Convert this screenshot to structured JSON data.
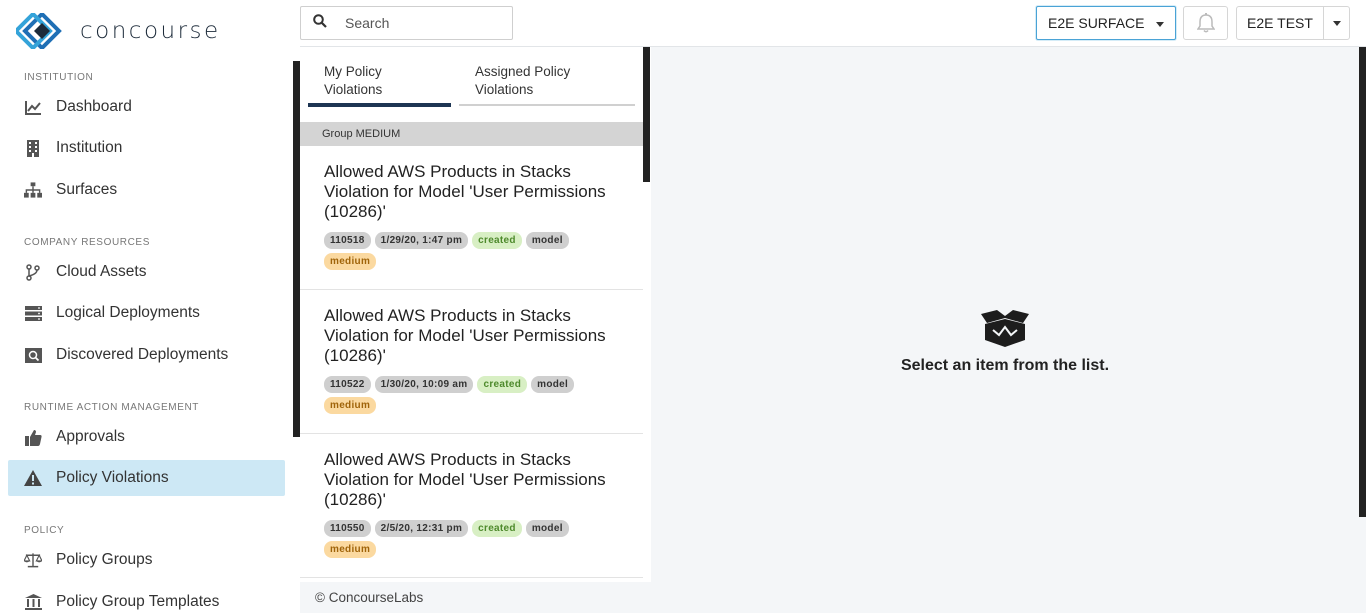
{
  "app": {
    "logo_text": "concourse",
    "brand_color": "#1f6fb5"
  },
  "sidebar": {
    "sections": [
      {
        "title": "INSTITUTION"
      },
      {
        "title": "COMPANY RESOURCES"
      },
      {
        "title": "RUNTIME ACTION MANAGEMENT"
      },
      {
        "title": "POLICY"
      }
    ],
    "items": [
      {
        "label": "Dashboard",
        "icon": "chart-line-icon"
      },
      {
        "label": "Institution",
        "icon": "building-icon"
      },
      {
        "label": "Surfaces",
        "icon": "sitemap-icon"
      },
      {
        "label": "Cloud Assets",
        "icon": "code-branch-icon"
      },
      {
        "label": "Logical Deployments",
        "icon": "server-icon"
      },
      {
        "label": "Discovered Deployments",
        "icon": "search-deployment-icon"
      },
      {
        "label": "Approvals",
        "icon": "thumbs-up-icon"
      },
      {
        "label": "Policy Violations",
        "icon": "warning-icon",
        "active": true
      },
      {
        "label": "Policy Groups",
        "icon": "balance-scale-icon"
      },
      {
        "label": "Policy Group Templates",
        "icon": "landmark-icon"
      }
    ]
  },
  "header": {
    "search_placeholder": "Search",
    "surface_selector": "E2E SURFACE",
    "user_name": "E2E TEST"
  },
  "list": {
    "tabs": [
      {
        "label": "My Policy Violations",
        "active": true
      },
      {
        "label": "Assigned Policy Violations",
        "active": false
      }
    ],
    "group_header": "Group MEDIUM",
    "violations": [
      {
        "title": "Allowed AWS Products in Stacks Violation for Model 'User Permissions (10286)'",
        "id": "110518",
        "date": "1/29/20, 1:47 pm",
        "status": "created",
        "type": "model",
        "severity": "medium"
      },
      {
        "title": "Allowed AWS Products in Stacks Violation for Model 'User Permissions (10286)'",
        "id": "110522",
        "date": "1/30/20, 10:09 am",
        "status": "created",
        "type": "model",
        "severity": "medium"
      },
      {
        "title": "Allowed AWS Products in Stacks Violation for Model 'User Permissions (10286)'",
        "id": "110550",
        "date": "2/5/20, 12:31 pm",
        "status": "created",
        "type": "model",
        "severity": "medium"
      }
    ]
  },
  "detail": {
    "empty_icon": "box-open-icon",
    "empty_message": "Select an item from the list."
  },
  "footer": {
    "text": "© ConcourseLabs"
  },
  "colors": {
    "active_nav_bg": "#cde8f5",
    "tab_active_underline": "#1d3553",
    "badge_created": "#d8efc4",
    "badge_medium": "#fbd9a0"
  }
}
